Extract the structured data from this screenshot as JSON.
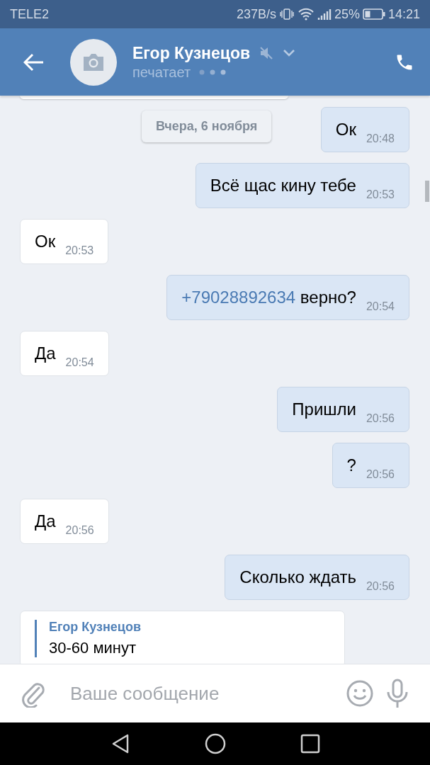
{
  "status_bar": {
    "carrier": "TELE2",
    "speed": "237B/s",
    "battery": "25%",
    "time": "14:21"
  },
  "header": {
    "name": "Егор Кузнецов",
    "status": "печатает",
    "muted": true
  },
  "date_divider": "Вчера, 6 ноября",
  "messages": [
    {
      "kind": "outgoing",
      "text": "Ок",
      "time": "20:48"
    },
    {
      "kind": "outgoing",
      "text": "Всё щас кину тебе",
      "time": "20:53"
    },
    {
      "kind": "incoming",
      "text": "Ок",
      "time": "20:53"
    },
    {
      "kind": "outgoing",
      "link": "+79028892634",
      "text": "верно?",
      "time": "20:54"
    },
    {
      "kind": "incoming",
      "text": "Да",
      "time": "20:54"
    },
    {
      "kind": "outgoing",
      "text": "Пришли",
      "time": "20:56"
    },
    {
      "kind": "outgoing",
      "text": "?",
      "time": "20:56"
    },
    {
      "kind": "incoming",
      "text": "Да",
      "time": "20:56"
    },
    {
      "kind": "outgoing",
      "text": "Сколько ждать",
      "time": "20:56"
    }
  ],
  "reply": {
    "author": "Егор Кузнецов",
    "text": "30-60 минут"
  },
  "composer": {
    "placeholder": "Ваше сообщение"
  }
}
